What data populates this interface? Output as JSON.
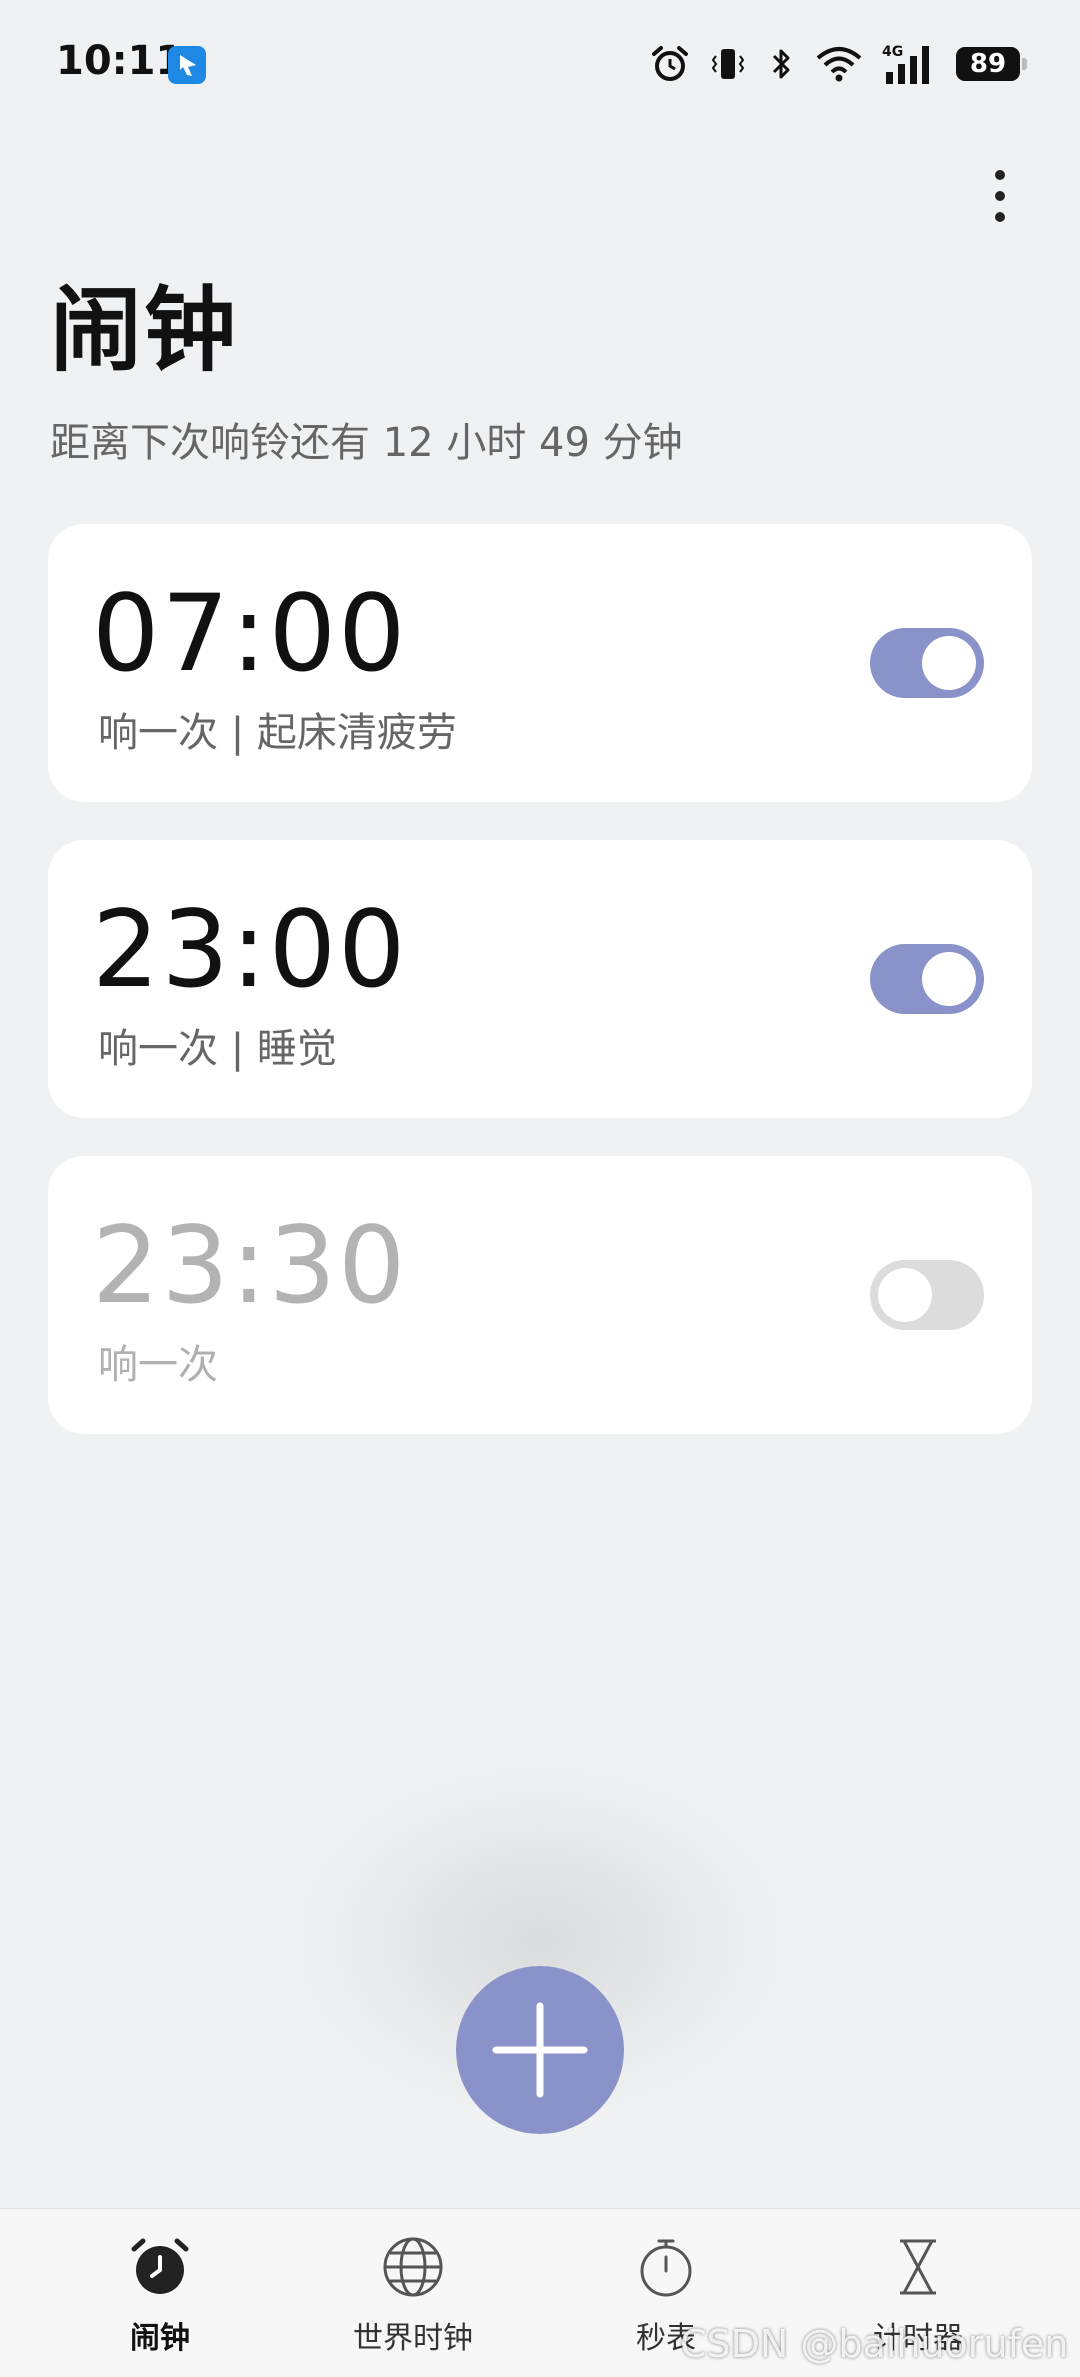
{
  "status_bar": {
    "time": "10:11",
    "battery": "89",
    "icons": [
      "alarm-icon",
      "vibrate-icon",
      "bluetooth-icon",
      "wifi-icon",
      "signal-4g-icon",
      "battery-icon"
    ]
  },
  "header": {
    "title": "闹钟",
    "subtitle": "距离下次响铃还有 12 小时 49 分钟"
  },
  "alarms": [
    {
      "time": "07:00",
      "label": "响一次 | 起床清疲劳",
      "enabled": true
    },
    {
      "time": "23:00",
      "label": "响一次 | 睡觉",
      "enabled": true
    },
    {
      "time": "23:30",
      "label": "响一次",
      "enabled": false
    }
  ],
  "colors": {
    "accent": "#8a93c9",
    "background": "#f0f1f3",
    "card": "#ffffff",
    "toggle_off": "#dcdcdc"
  },
  "bottom_nav": {
    "active": "alarm",
    "items": [
      {
        "id": "alarm",
        "label": "闹钟",
        "icon": "alarm-clock-icon"
      },
      {
        "id": "world-clock",
        "label": "世界时钟",
        "icon": "globe-icon"
      },
      {
        "id": "stopwatch",
        "label": "秒表",
        "icon": "stopwatch-icon"
      },
      {
        "id": "timer",
        "label": "计时器",
        "icon": "hourglass-icon"
      }
    ]
  },
  "watermark": "CSDN @baihuorufen"
}
